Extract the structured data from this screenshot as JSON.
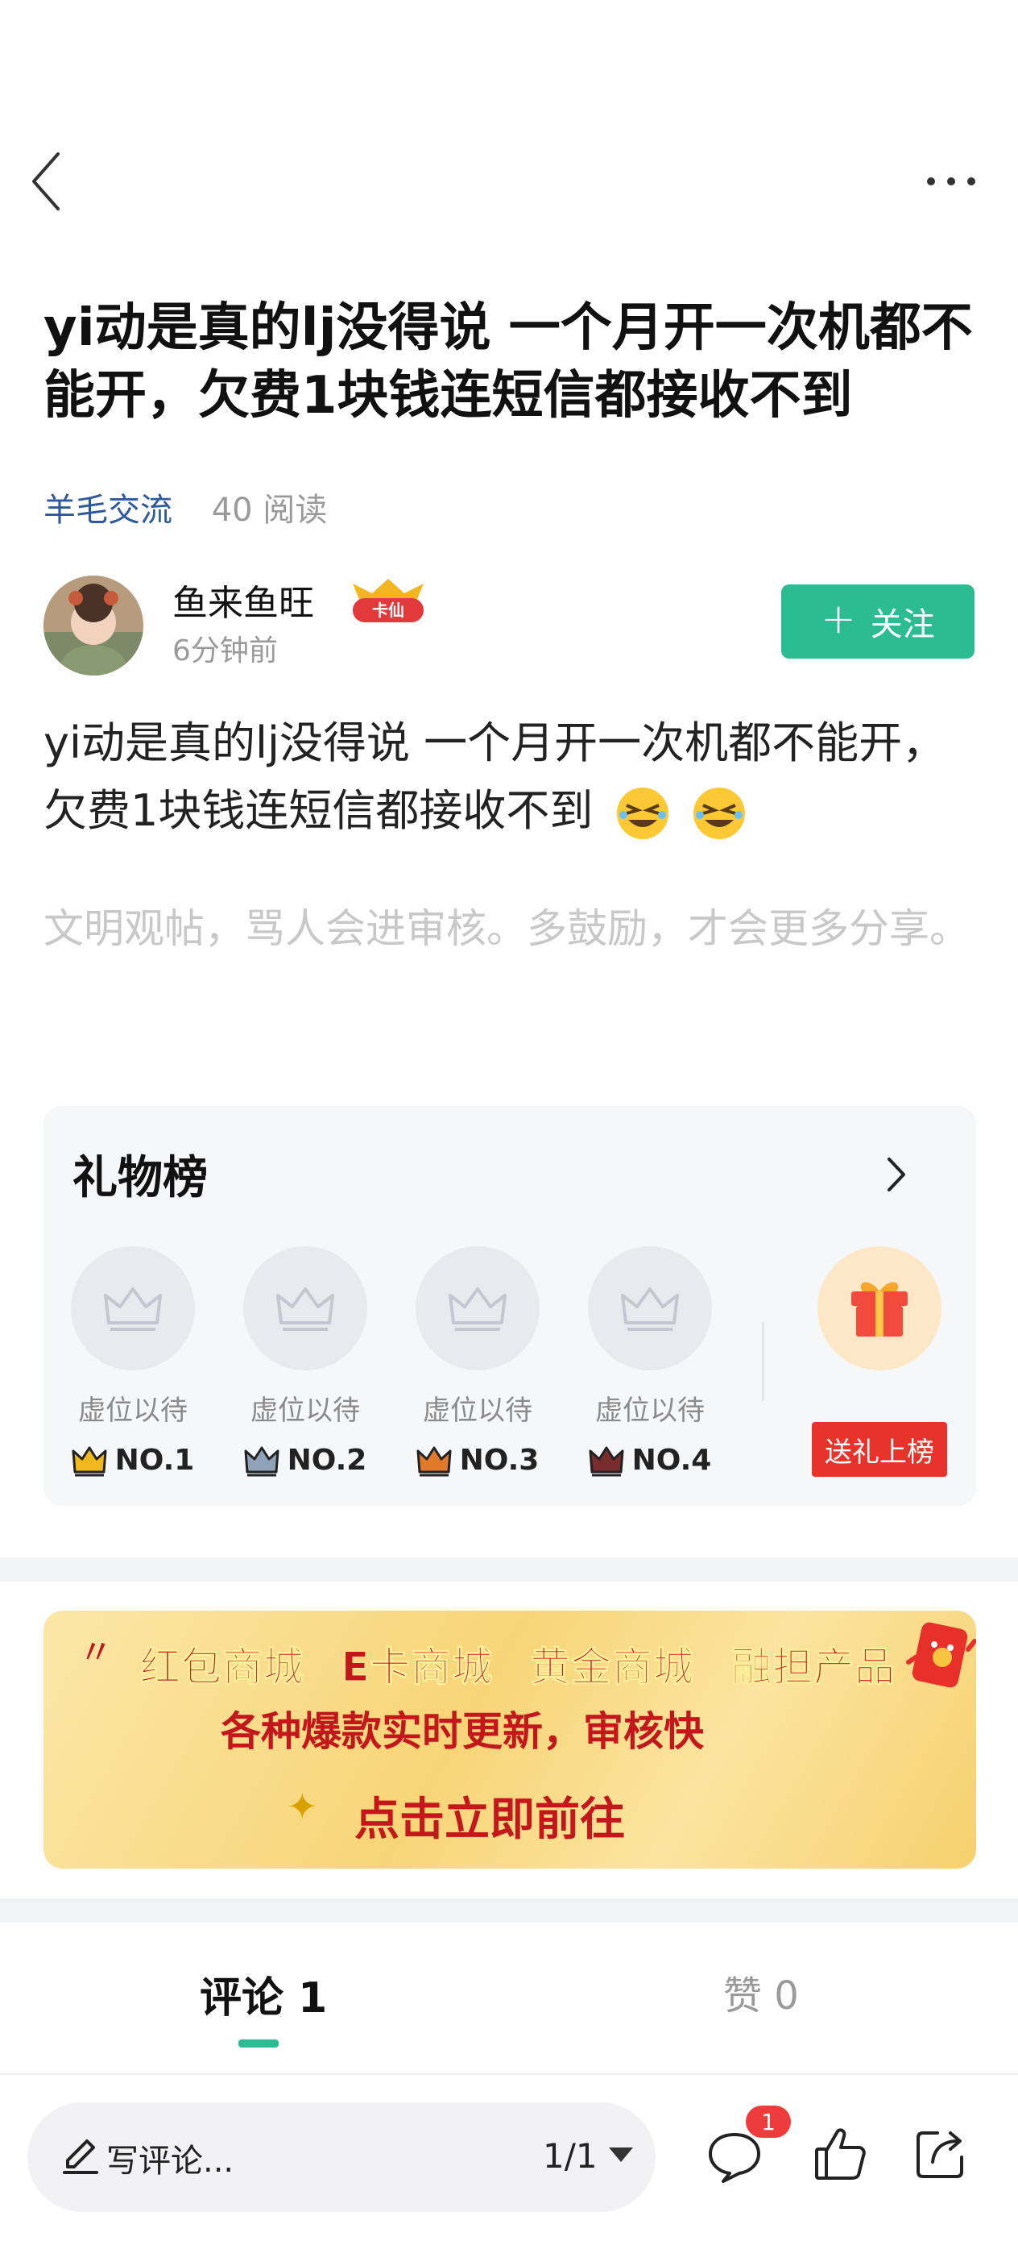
{
  "post": {
    "title": "yi动是真的lj没得说 一个月开一次机都不能开，欠费1块钱连短信都接收不到",
    "category": "羊毛交流",
    "reads": "40 阅读",
    "author": "鱼来鱼旺",
    "author_badge": "卡仙",
    "time": "6分钟前",
    "follow_label": "关注",
    "body": "yi动是真的lj没得说  一个月开一次机都不能开，欠费1块钱连短信都接收不到",
    "hint": "文明观帖，骂人会进审核。多鼓励，才会更多分享。"
  },
  "gift_board": {
    "title": "礼物榜",
    "slots": [
      {
        "label": "虚位以待",
        "rank": "NO.1",
        "crown_color": "#f0b81c"
      },
      {
        "label": "虚位以待",
        "rank": "NO.2",
        "crown_color": "#8fa2b8"
      },
      {
        "label": "虚位以待",
        "rank": "NO.3",
        "crown_color": "#e07a2a"
      },
      {
        "label": "虚位以待",
        "rank": "NO.4",
        "crown_color": "#7a2c2c"
      }
    ],
    "send_label": "送礼上榜"
  },
  "banner": {
    "row1": [
      "红包商城",
      "E卡商城",
      "黄金商城",
      "融担产品"
    ],
    "row2": "各种爆款实时更新，审核快",
    "row3": "点击立即前往"
  },
  "tabs": {
    "comments": "评论 1",
    "likes": "赞 0"
  },
  "bottom_bar": {
    "write_placeholder": "写评论...",
    "page": "1/1",
    "comment_count": "1"
  },
  "colors": {
    "accent": "#2bbc91",
    "category": "#2d5a9b",
    "red": "#e7332b"
  }
}
